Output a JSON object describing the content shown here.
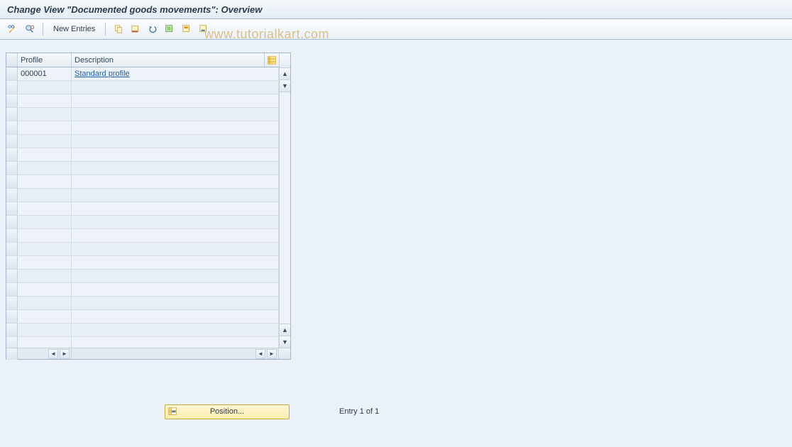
{
  "title": "Change View \"Documented goods movements\": Overview",
  "toolbar": {
    "new_entries": "New Entries"
  },
  "watermark": "www.tutorialkart.com",
  "table": {
    "columns": {
      "profile": "Profile",
      "description": "Description"
    },
    "rows": [
      {
        "profile": "000001",
        "description": "Standard profile"
      }
    ],
    "blank_row_count": 20
  },
  "footer": {
    "position_button": "Position...",
    "entry_text": "Entry 1 of 1"
  }
}
